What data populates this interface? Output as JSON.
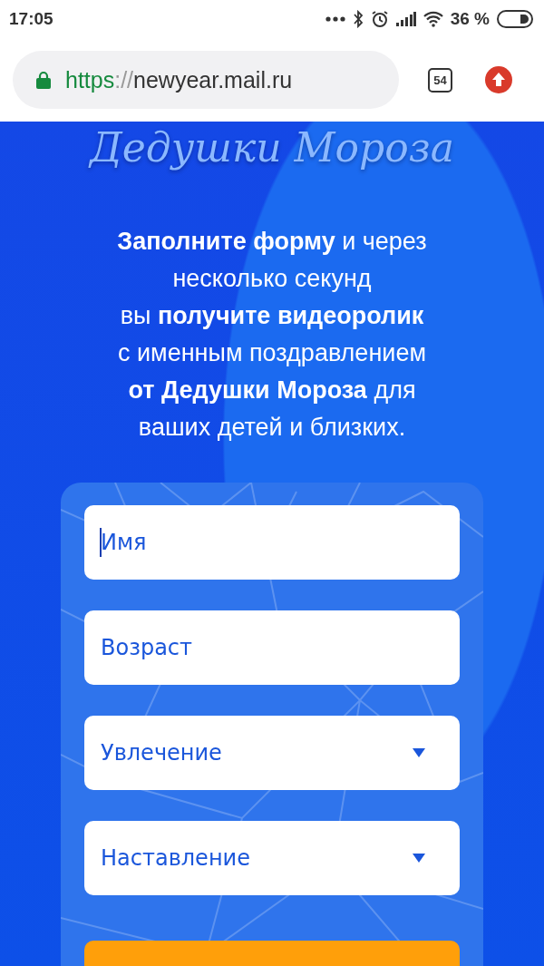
{
  "status_bar": {
    "time": "17:05",
    "battery": "36 %"
  },
  "browser": {
    "url_scheme": "https",
    "url_separator": "://",
    "url_host": "newyear.mail.ru",
    "tab_count": "54"
  },
  "logo": "Дедушки Мороза",
  "intro": "**Заполните форму** и через\nнесколько секунд\nвы **получите видеоролик**\nс именным поздравлением\n**от Дедушки Мороза** для\nваших детей и близких.",
  "form": {
    "fields": [
      {
        "kind": "text",
        "placeholder": "Имя",
        "focused": true
      },
      {
        "kind": "text",
        "placeholder": "Возраст",
        "focused": false
      },
      {
        "kind": "select",
        "placeholder": "Увлечение",
        "focused": false
      },
      {
        "kind": "select",
        "placeholder": "Наставление",
        "focused": false
      }
    ]
  }
}
